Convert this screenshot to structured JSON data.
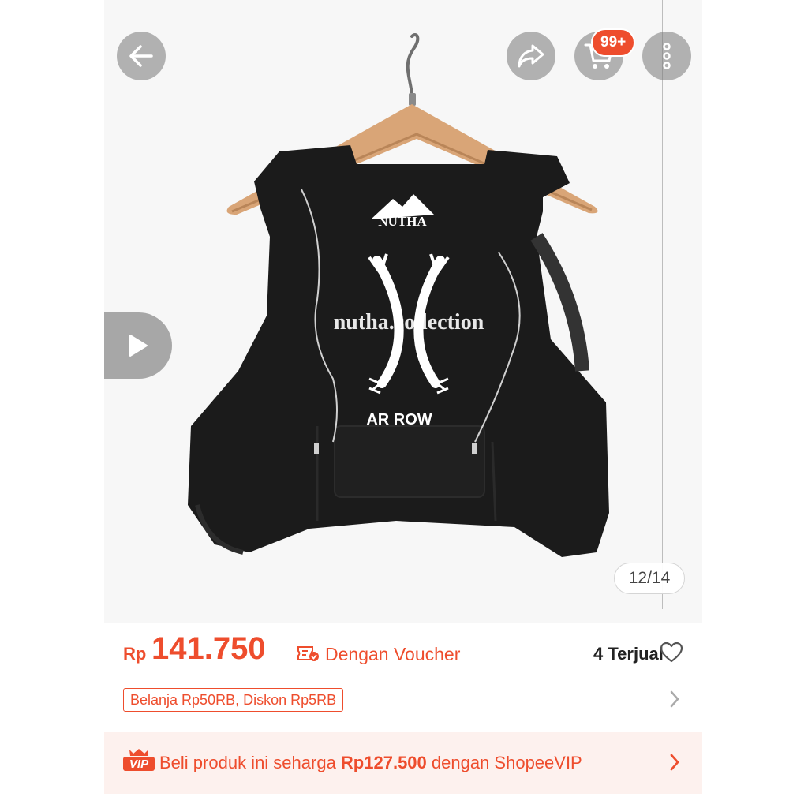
{
  "gallery": {
    "watermark": "nutha.collection",
    "logo_brand": "NUTHA",
    "print_text": "AR ROW",
    "counter": "12/14"
  },
  "header": {
    "back_icon": "arrow-left-icon",
    "share_icon": "share-arrow-icon",
    "cart_icon": "cart-icon",
    "cart_badge": "99+",
    "more_icon": "more-vertical-icon"
  },
  "video": {
    "icon": "play-icon"
  },
  "price": {
    "currency": "Rp",
    "value": "141.750",
    "voucher_icon": "voucher-icon",
    "voucher_label": "Dengan Voucher",
    "sold": "4 Terjual",
    "wishlist_icon": "heart-icon"
  },
  "promo": {
    "tag": "Belanja Rp50RB, Diskon Rp5RB",
    "chevron_icon": "chevron-right-icon"
  },
  "vip": {
    "badge_icon": "vip-crown-icon",
    "badge_text": "VIP",
    "text_before": "Beli produk ini seharga ",
    "price": "Rp127.500",
    "text_after": " dengan ShopeeVIP",
    "chevron_icon": "chevron-right-icon"
  },
  "colors": {
    "accent": "#ee4d2d",
    "vip_bg": "#fdf1ee",
    "vest": "#1b1b1b"
  }
}
